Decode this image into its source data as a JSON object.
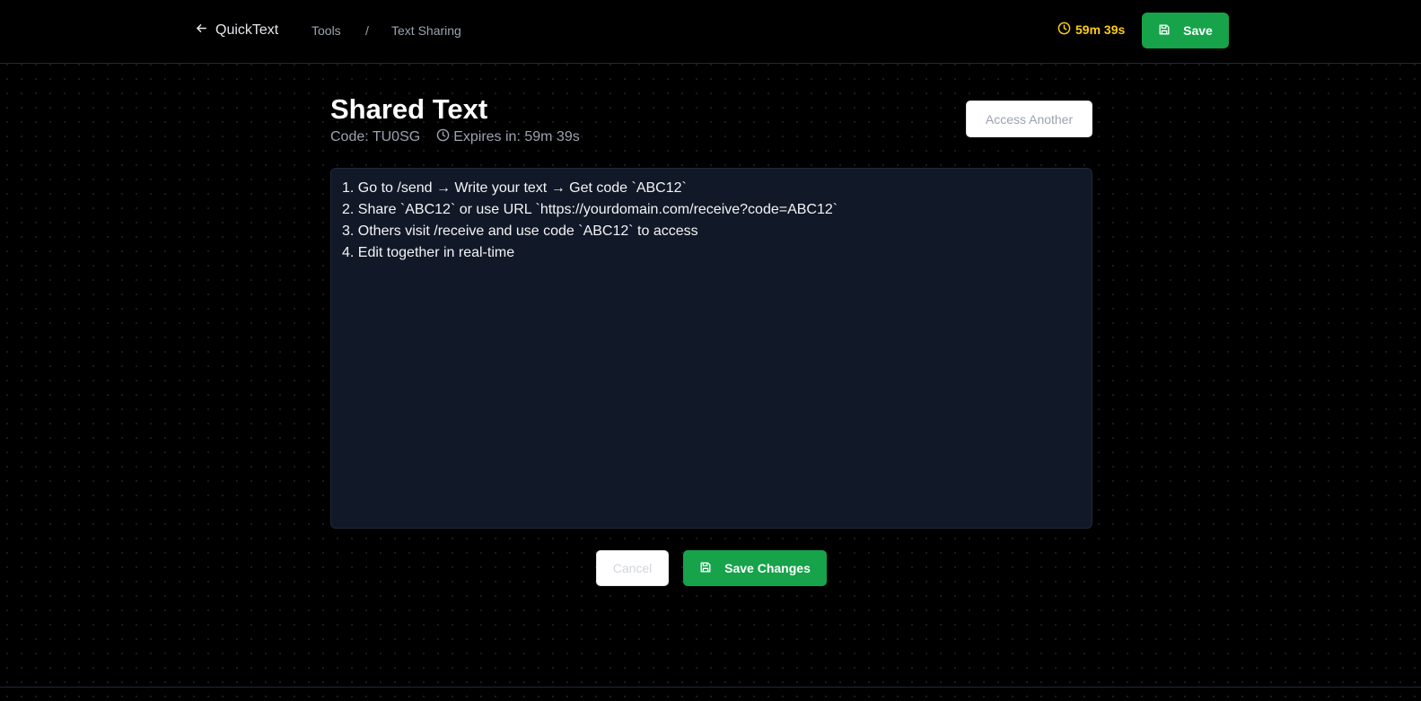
{
  "header": {
    "brand": "QuickText",
    "breadcrumb": [
      "Tools",
      "/",
      "Text Sharing"
    ],
    "timer": "59m 39s",
    "save_label": "Save"
  },
  "main": {
    "title": "Shared Text",
    "code_label": "Code: TU0SG",
    "expires_label": "Expires in: 59m 39s",
    "access_another_label": "Access Another",
    "editor_text": "1. Go to /send → Write your text → Get code `ABC12`\n2. Share `ABC12` or use URL `https://yourdomain.com/receive?code=ABC12`\n3. Others visit /receive and use code `ABC12` to access\n4. Edit together in real-time",
    "cancel_label": "Cancel",
    "save_changes_label": "Save Changes"
  },
  "colors": {
    "accent": "#16a34a",
    "timer": "#facc15",
    "background": "#000000",
    "editor_bg": "#111827"
  },
  "icons": {
    "back": "arrow-left-icon",
    "clock": "clock-icon",
    "save": "save-icon"
  }
}
